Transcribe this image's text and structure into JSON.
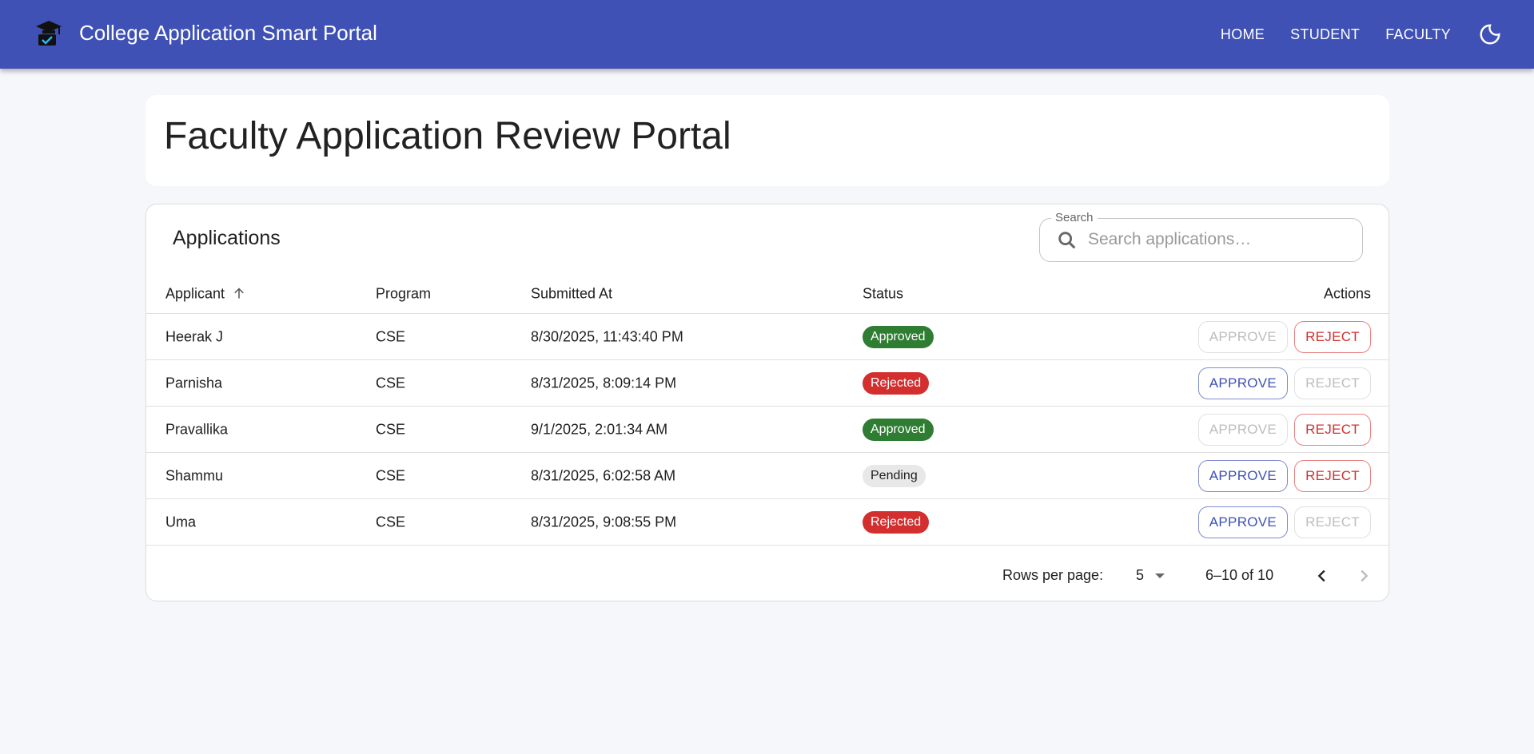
{
  "appbar": {
    "title": "College Application Smart Portal",
    "nav": [
      "HOME",
      "STUDENT",
      "FACULTY"
    ],
    "theme_icon": "moon-icon"
  },
  "page": {
    "title": "Faculty Application Review Portal"
  },
  "applications": {
    "heading": "Applications",
    "search": {
      "label": "Search",
      "placeholder": "Search applications…",
      "value": ""
    },
    "columns": {
      "applicant": "Applicant",
      "program": "Program",
      "submitted": "Submitted At",
      "status": "Status",
      "actions": "Actions"
    },
    "sort": {
      "column": "Applicant",
      "direction": "ascending"
    },
    "rows": [
      {
        "applicant": "Heerak J",
        "program": "CSE",
        "submitted": "8/30/2025, 11:43:40 PM",
        "status": "Approved",
        "approve": "APPROVE",
        "reject": "REJECT",
        "approve_enabled": false,
        "reject_enabled": true
      },
      {
        "applicant": "Parnisha",
        "program": "CSE",
        "submitted": "8/31/2025, 8:09:14 PM",
        "status": "Rejected",
        "approve": "APPROVE",
        "reject": "REJECT",
        "approve_enabled": true,
        "reject_enabled": false
      },
      {
        "applicant": "Pravallika",
        "program": "CSE",
        "submitted": "9/1/2025, 2:01:34 AM",
        "status": "Approved",
        "approve": "APPROVE",
        "reject": "REJECT",
        "approve_enabled": false,
        "reject_enabled": true
      },
      {
        "applicant": "Shammu",
        "program": "CSE",
        "submitted": "8/31/2025, 6:02:58 AM",
        "status": "Pending",
        "approve": "APPROVE",
        "reject": "REJECT",
        "approve_enabled": true,
        "reject_enabled": true
      },
      {
        "applicant": "Uma",
        "program": "CSE",
        "submitted": "8/31/2025, 9:08:55 PM",
        "status": "Rejected",
        "approve": "APPROVE",
        "reject": "REJECT",
        "approve_enabled": true,
        "reject_enabled": false
      }
    ],
    "pagination": {
      "rows_label": "Rows per page:",
      "rows_value": "5",
      "range": "6–10 of 10",
      "prev_enabled": true,
      "next_enabled": false
    }
  },
  "colors": {
    "primary": "#3f51b5",
    "approved": "#2e7d32",
    "rejected": "#d32f2f",
    "pending": "#e8e8e8"
  }
}
